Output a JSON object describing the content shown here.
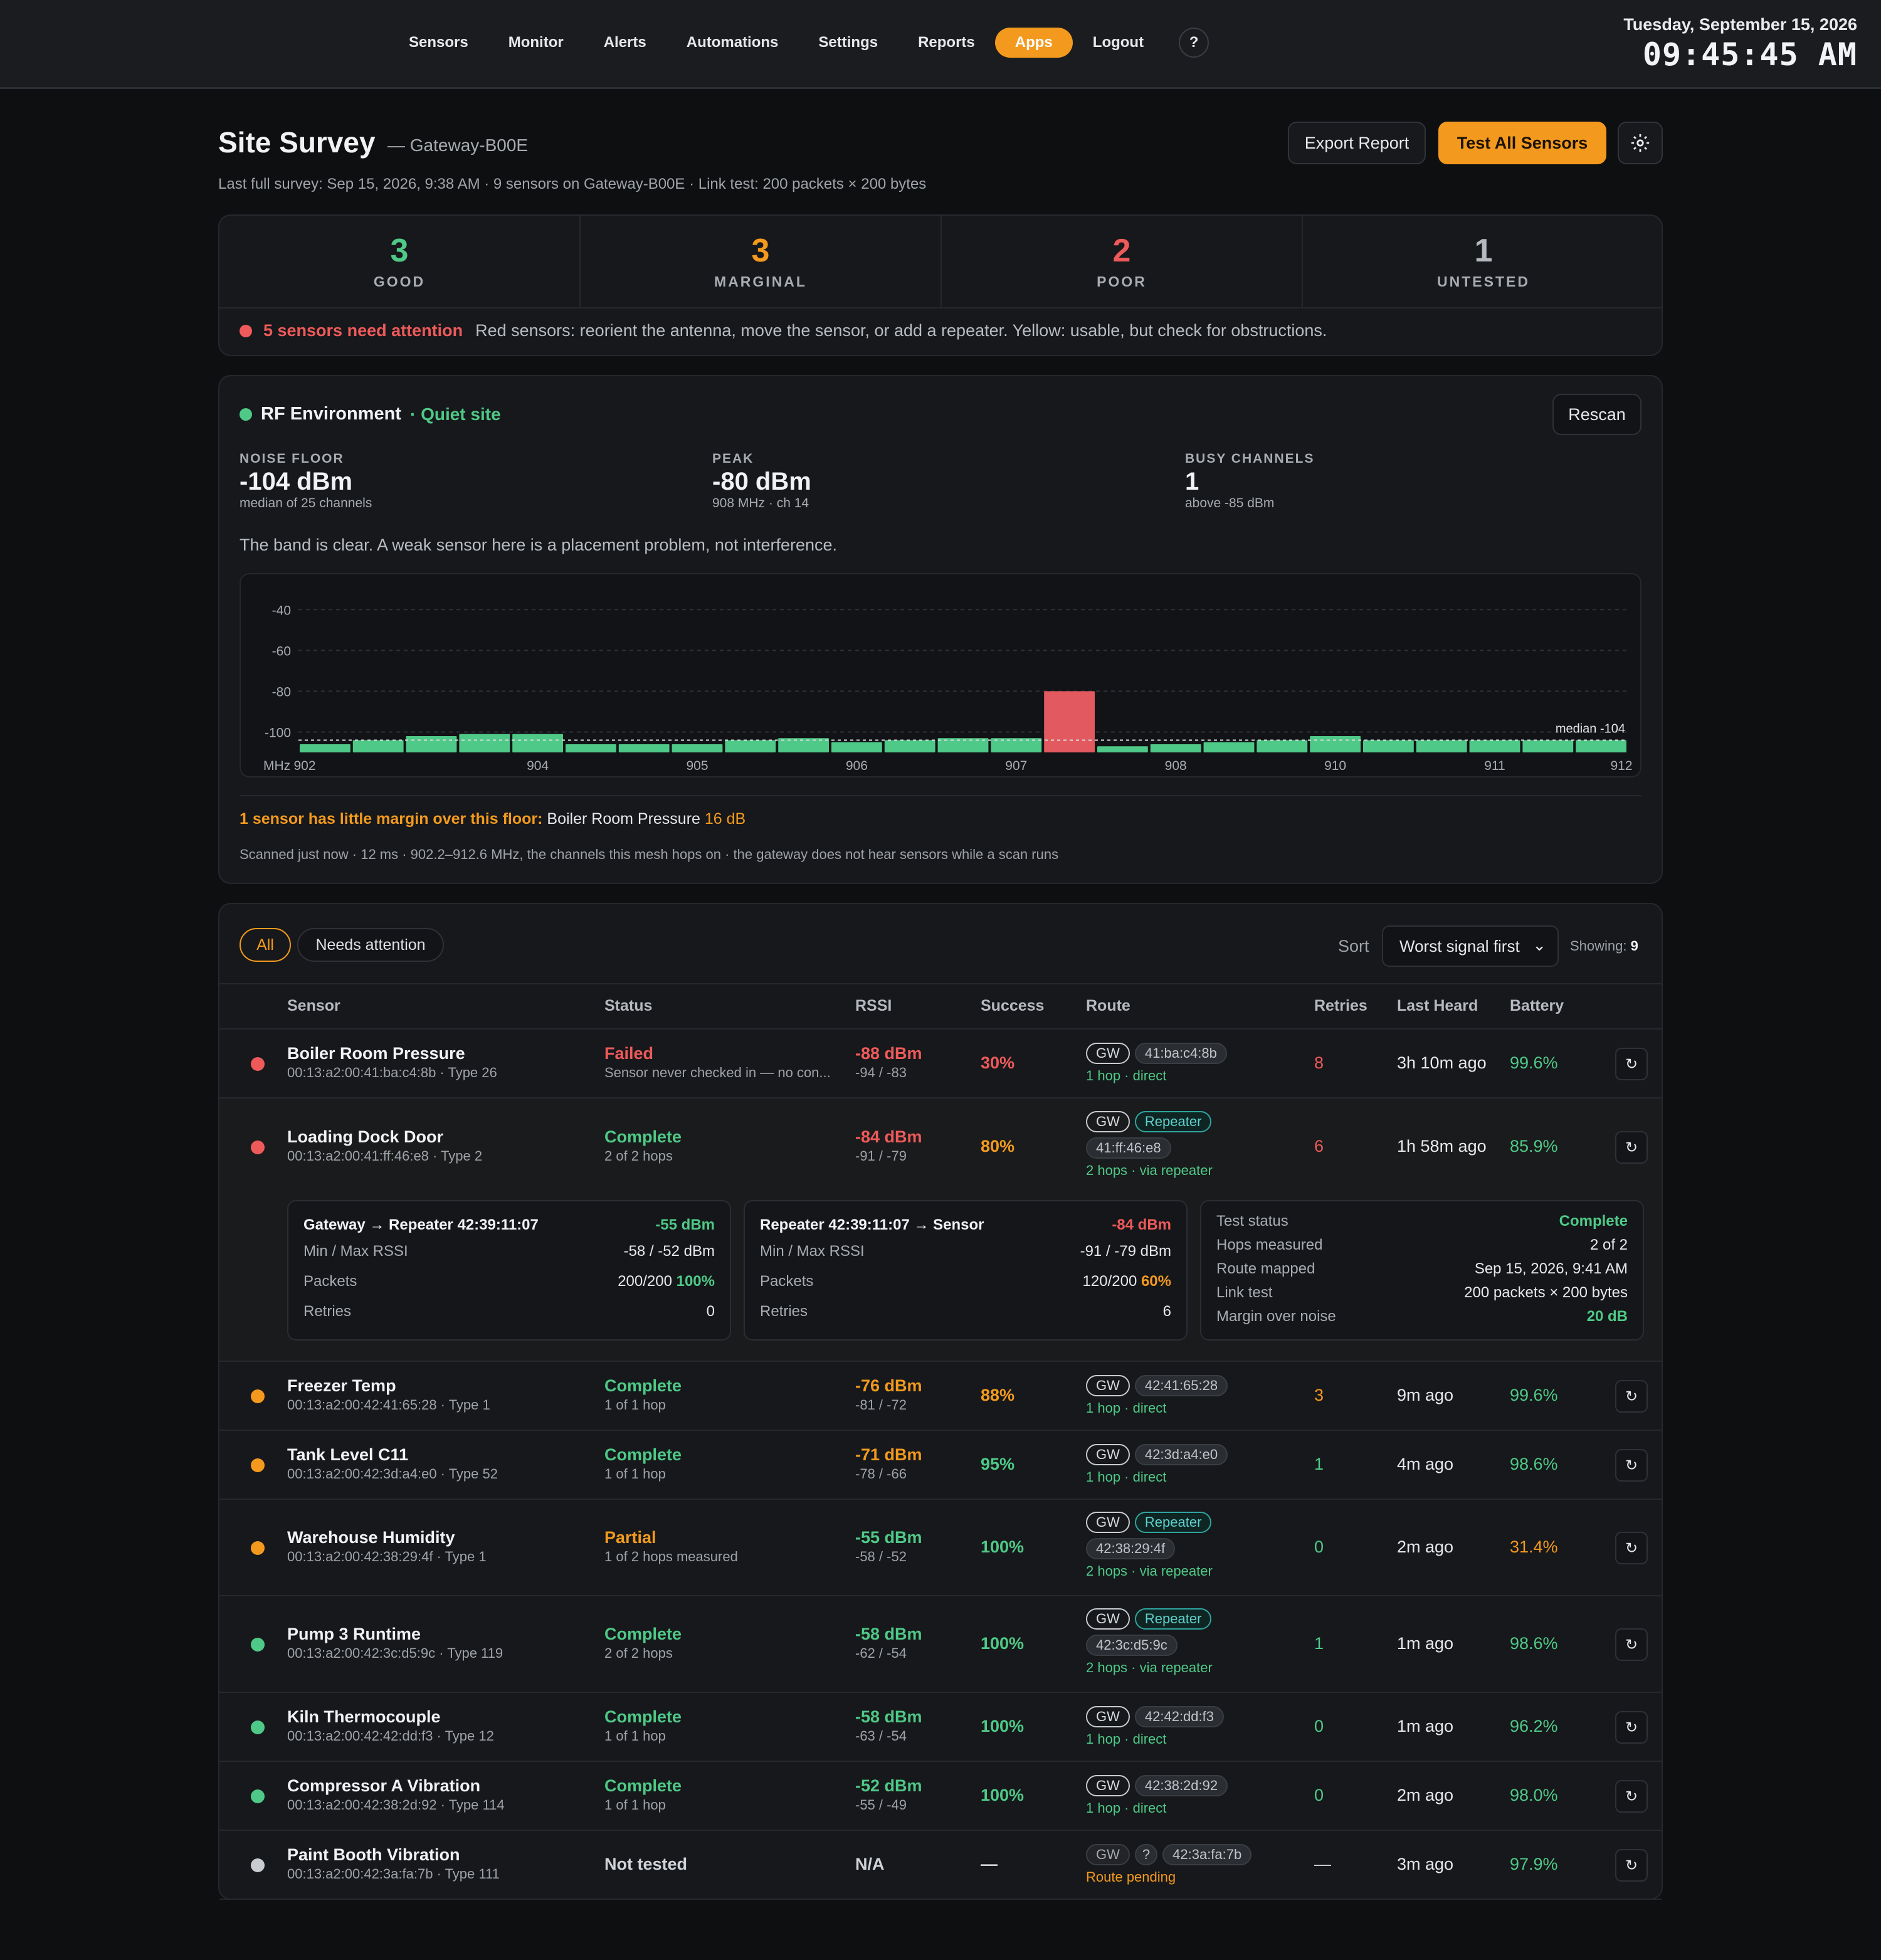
{
  "nav": {
    "items": [
      "Sensors",
      "Monitor",
      "Alerts",
      "Automations",
      "Settings",
      "Reports",
      "Apps",
      "Logout"
    ],
    "active": "Apps",
    "help": "?"
  },
  "clock": {
    "date": "Tuesday, September 15, 2026",
    "time": "09:45:45 AM"
  },
  "header": {
    "title": "Site Survey",
    "gateway": "— Gateway-B00E",
    "subtitle": "Last full survey: Sep 15, 2026, 9:38 AM · 9 sensors on Gateway-B00E · Link test: 200 packets × 200 bytes",
    "export_label": "Export Report",
    "test_label": "Test All Sensors"
  },
  "summary": {
    "good": {
      "count": "3",
      "label": "GOOD"
    },
    "marginal": {
      "count": "3",
      "label": "MARGINAL"
    },
    "poor": {
      "count": "2",
      "label": "POOR"
    },
    "untested": {
      "count": "1",
      "label": "UNTESTED"
    },
    "attention_title": "5 sensors need attention",
    "attention_text": "Red sensors: reorient the antenna, move the sensor, or add a repeater. Yellow: usable, but check for obstructions."
  },
  "rf": {
    "title": "RF Environment",
    "status": "· Quiet site",
    "rescan_label": "Rescan",
    "noise_label": "NOISE FLOOR",
    "noise_value": "-104 dBm",
    "noise_sub": "median of 25 channels",
    "peak_label": "PEAK",
    "peak_value": "-80 dBm",
    "peak_sub": "908 MHz · ch 14",
    "busy_label": "BUSY CHANNELS",
    "busy_value": "1",
    "busy_sub": "above -85 dBm",
    "description": "The band is clear. A weak sensor here is a placement problem, not interference.",
    "warn_prefix": "1 sensor has little margin over this floor:",
    "warn_sensor": "Boiler Room Pressure",
    "warn_margin": "16 dB",
    "footnote": "Scanned just now · 12 ms · 902.2–912.6 MHz, the channels this mesh hops on · the gateway does not hear sensors while a scan runs"
  },
  "chart_data": {
    "type": "bar",
    "xlabel": "MHz",
    "ylim": [
      -110,
      -35
    ],
    "yticks": [
      -40,
      -60,
      -80,
      -100
    ],
    "xtick_labels": [
      "902",
      "904",
      "905",
      "906",
      "907",
      "908",
      "910",
      "911",
      "912"
    ],
    "median_label": "median -104",
    "median": -104,
    "values": [
      -106,
      -104,
      -102,
      -101,
      -101,
      -106,
      -106,
      -106,
      -104,
      -103,
      -105,
      -104,
      -103,
      -103,
      -80,
      -107,
      -106,
      -105,
      -104,
      -102,
      -104,
      -104,
      -104,
      -104,
      -104
    ],
    "highlight_index": 14,
    "colors": {
      "normal": "#4fc987",
      "busy": "#e25a5f"
    },
    "grid": true
  },
  "table": {
    "filter_all": "All",
    "filter_attention": "Needs attention",
    "sort_label": "Sort",
    "sort_value": "Worst signal first",
    "showing_label": "Showing:",
    "showing_count": "9",
    "headers": {
      "sensor": "Sensor",
      "status": "Status",
      "rssi": "RSSI",
      "success": "Success",
      "route": "Route",
      "retries": "Retries",
      "last": "Last Heard",
      "battery": "Battery"
    },
    "rows": [
      {
        "dot": "red",
        "name": "Boiler Room Pressure",
        "id": "00:13:a2:00:41:ba:c4:8b · Type 26",
        "status": "Failed",
        "status_color": "red",
        "status_sub": "Sensor never checked in — no con...",
        "rssi": "-88 dBm",
        "rssi_color": "red",
        "rssi_sub": "-94 / -83",
        "success": "30%",
        "success_color": "red",
        "tags": [
          "GW"
        ],
        "mac": "41:ba:c4:8b",
        "route": "1 hop · direct",
        "route_color": "green",
        "retries": "8",
        "retries_color": "red",
        "last": "3h 10m ago",
        "battery": "99.6%",
        "battery_color": "green"
      },
      {
        "dot": "red",
        "name": "Loading Dock Door",
        "id": "00:13:a2:00:41:ff:46:e8 · Type 2",
        "status": "Complete",
        "status_color": "green",
        "status_sub": "2 of 2 hops",
        "rssi": "-84 dBm",
        "rssi_color": "red",
        "rssi_sub": "-91 / -79",
        "success": "80%",
        "success_color": "orange",
        "tags": [
          "GW",
          "Repeater"
        ],
        "mac": "41:ff:46:e8",
        "route": "2 hops · via repeater",
        "route_color": "green",
        "retries": "6",
        "retries_color": "red",
        "last": "1h 58m ago",
        "battery": "85.9%",
        "battery_color": "green"
      },
      {
        "dot": "orange",
        "name": "Freezer Temp",
        "id": "00:13:a2:00:42:41:65:28 · Type 1",
        "status": "Complete",
        "status_color": "green",
        "status_sub": "1 of 1 hop",
        "rssi": "-76 dBm",
        "rssi_color": "orange",
        "rssi_sub": "-81 / -72",
        "success": "88%",
        "success_color": "orange",
        "tags": [
          "GW"
        ],
        "mac": "42:41:65:28",
        "route": "1 hop · direct",
        "route_color": "green",
        "retries": "3",
        "retries_color": "orange",
        "last": "9m ago",
        "battery": "99.6%",
        "battery_color": "green"
      },
      {
        "dot": "orange",
        "name": "Tank Level C11",
        "id": "00:13:a2:00:42:3d:a4:e0 · Type 52",
        "status": "Complete",
        "status_color": "green",
        "status_sub": "1 of 1 hop",
        "rssi": "-71 dBm",
        "rssi_color": "orange",
        "rssi_sub": "-78 / -66",
        "success": "95%",
        "success_color": "green",
        "tags": [
          "GW"
        ],
        "mac": "42:3d:a4:e0",
        "route": "1 hop · direct",
        "route_color": "green",
        "retries": "1",
        "retries_color": "green",
        "last": "4m ago",
        "battery": "98.6%",
        "battery_color": "green"
      },
      {
        "dot": "orange",
        "name": "Warehouse Humidity",
        "id": "00:13:a2:00:42:38:29:4f · Type 1",
        "status": "Partial",
        "status_color": "orange",
        "status_sub": "1 of 2 hops measured",
        "rssi": "-55 dBm",
        "rssi_color": "green",
        "rssi_sub": "-58 / -52",
        "success": "100%",
        "success_color": "green",
        "tags": [
          "GW",
          "Repeater"
        ],
        "mac": "42:38:29:4f",
        "route": "2 hops · via repeater",
        "route_color": "green",
        "retries": "0",
        "retries_color": "green",
        "last": "2m ago",
        "battery": "31.4%",
        "battery_color": "orange"
      },
      {
        "dot": "green",
        "name": "Pump 3 Runtime",
        "id": "00:13:a2:00:42:3c:d5:9c · Type 119",
        "status": "Complete",
        "status_color": "green",
        "status_sub": "2 of 2 hops",
        "rssi": "-58 dBm",
        "rssi_color": "green",
        "rssi_sub": "-62 / -54",
        "success": "100%",
        "success_color": "green",
        "tags": [
          "GW",
          "Repeater"
        ],
        "mac": "42:3c:d5:9c",
        "route": "2 hops · via repeater",
        "route_color": "green",
        "retries": "1",
        "retries_color": "green",
        "last": "1m ago",
        "battery": "98.6%",
        "battery_color": "green"
      },
      {
        "dot": "green",
        "name": "Kiln Thermocouple",
        "id": "00:13:a2:00:42:42:dd:f3 · Type 12",
        "status": "Complete",
        "status_color": "green",
        "status_sub": "1 of 1 hop",
        "rssi": "-58 dBm",
        "rssi_color": "green",
        "rssi_sub": "-63 / -54",
        "success": "100%",
        "success_color": "green",
        "tags": [
          "GW"
        ],
        "mac": "42:42:dd:f3",
        "route": "1 hop · direct",
        "route_color": "green",
        "retries": "0",
        "retries_color": "green",
        "last": "1m ago",
        "battery": "96.2%",
        "battery_color": "green"
      },
      {
        "dot": "green",
        "name": "Compressor A Vibration",
        "id": "00:13:a2:00:42:38:2d:92 · Type 114",
        "status": "Complete",
        "status_color": "green",
        "status_sub": "1 of 1 hop",
        "rssi": "-52 dBm",
        "rssi_color": "green",
        "rssi_sub": "-55 / -49",
        "success": "100%",
        "success_color": "green",
        "tags": [
          "GW"
        ],
        "mac": "42:38:2d:92",
        "route": "1 hop · direct",
        "route_color": "green",
        "retries": "0",
        "retries_color": "green",
        "last": "2m ago",
        "battery": "98.0%",
        "battery_color": "green"
      },
      {
        "dot": "gray",
        "name": "Paint Booth Vibration",
        "id": "00:13:a2:00:42:3a:fa:7b · Type 111",
        "status": "Not tested",
        "status_color": "gray",
        "status_sub": "",
        "rssi": "N/A",
        "rssi_color": "gray",
        "rssi_sub": "",
        "success": "—",
        "success_color": "gray",
        "tags": [
          "GW",
          "?"
        ],
        "mac": "42:3a:fa:7b",
        "route": "Route pending",
        "route_color": "orange",
        "retries": "—",
        "retries_color": "gray",
        "last": "3m ago",
        "battery": "97.9%",
        "battery_color": "green"
      }
    ],
    "detail": {
      "hop1": {
        "title": "Gateway → Repeater 42:39:11:07",
        "rssi": "-55 dBm",
        "minmax_label": "Min / Max RSSI",
        "minmax": "-58 / -52 dBm",
        "packets_label": "Packets",
        "packets": "200/200",
        "packets_pct": "100%",
        "retries_label": "Retries",
        "retries": "0"
      },
      "hop2": {
        "title": "Repeater 42:39:11:07 → Sensor",
        "rssi": "-84 dBm",
        "minmax_label": "Min / Max RSSI",
        "minmax": "-91 / -79 dBm",
        "packets_label": "Packets",
        "packets": "120/200",
        "packets_pct": "60%",
        "retries_label": "Retries",
        "retries": "6"
      },
      "info": {
        "status_label": "Test status",
        "status": "Complete",
        "hops_label": "Hops measured",
        "hops": "2 of 2",
        "mapped_label": "Route mapped",
        "mapped": "Sep 15, 2026, 9:41 AM",
        "link_label": "Link test",
        "link": "200 packets × 200 bytes",
        "margin_label": "Margin over noise",
        "margin": "20 dB"
      }
    }
  },
  "colors": {
    "accent": "#f39a1e",
    "good": "#4fc987",
    "poor": "#ee5a5a",
    "busy": "#e25a5f",
    "bg": "#0e0f11"
  }
}
